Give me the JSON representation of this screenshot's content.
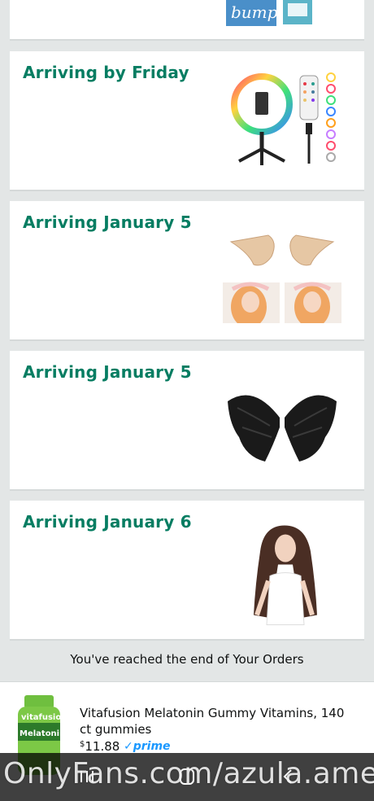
{
  "orders": [
    {
      "title": "Arriving by Friday",
      "product_icon": "ring-light-tripod"
    },
    {
      "title": "Arriving January 5",
      "product_icon": "elf-ears"
    },
    {
      "title": "Arriving January 5",
      "product_icon": "black-angel-wings"
    },
    {
      "title": "Arriving January 6",
      "product_icon": "long-brown-wig"
    }
  ],
  "top_card": {
    "product_label": "bumps"
  },
  "end_message": "You've reached the end of Your Orders",
  "recommendation": {
    "name": "Vitafusion Melatonin Gummy Vitamins, 140 ct gummies",
    "currency": "$",
    "price": "11.88",
    "prime_label": "prime",
    "bottle_brand": "vitafusion",
    "bottle_label": "Melatonin"
  },
  "watermark": "OnlyFans.com/azula.ame",
  "colors": {
    "title": "#067d62",
    "prime": "#1a98ff",
    "background": "#e3e6e6"
  }
}
